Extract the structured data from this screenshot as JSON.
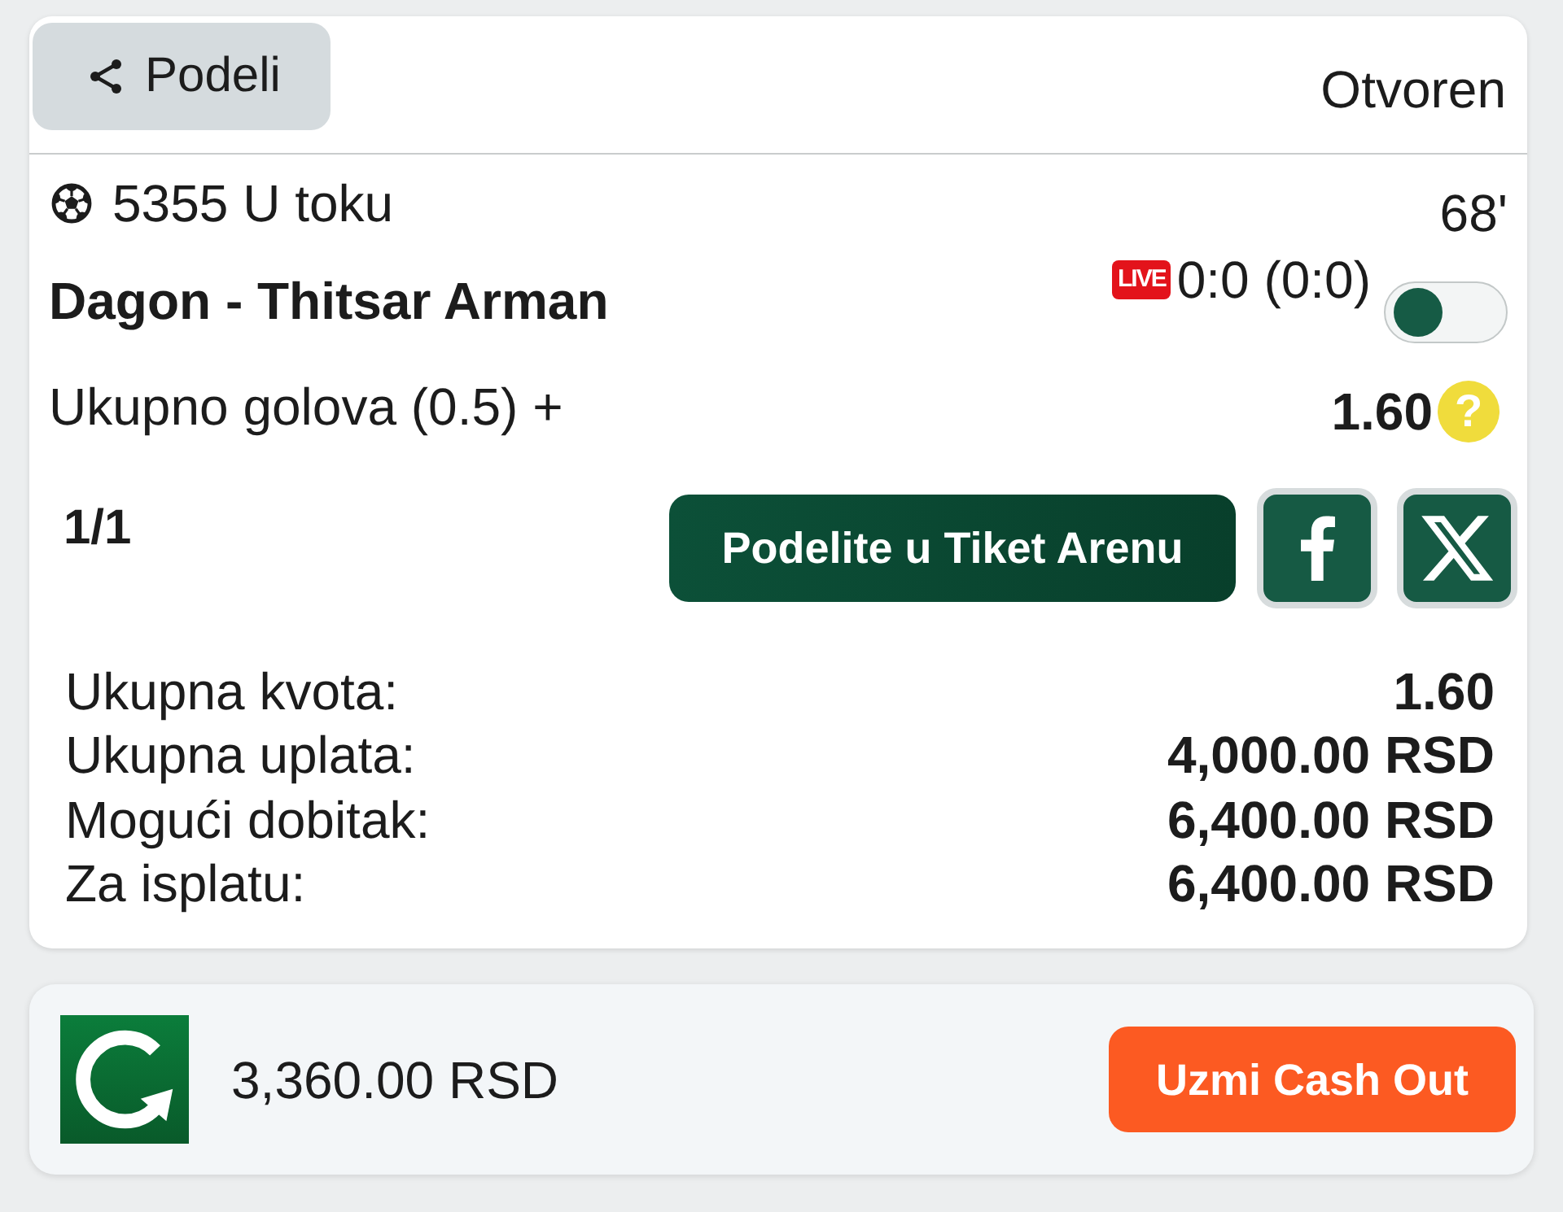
{
  "header": {
    "share_button": "Podeli",
    "status": "Otvoren"
  },
  "event": {
    "code_status": "5355 U toku",
    "minute": "68'",
    "match": "Dagon - Thitsar Arman",
    "live_badge": "LIVE",
    "score": "0:0 (0:0)",
    "toggle": {
      "on": false
    },
    "market": "Ukupno golova (0.5) +",
    "odds": "1.60",
    "help_mark": "?"
  },
  "ticket": {
    "count": "1/1",
    "arena_button": "Podelite u Tiket Arenu"
  },
  "summary": [
    {
      "label": "Ukupna kvota:",
      "value": "1.60"
    },
    {
      "label": "Ukupna uplata:",
      "value": "4,000.00 RSD"
    },
    {
      "label": "Mogući dobitak:",
      "value": "6,400.00 RSD"
    },
    {
      "label": "Za isplatu:",
      "value": "6,400.00 RSD"
    }
  ],
  "cash_out": {
    "amount": "3,360.00 RSD",
    "button": "Uzmi Cash Out"
  }
}
